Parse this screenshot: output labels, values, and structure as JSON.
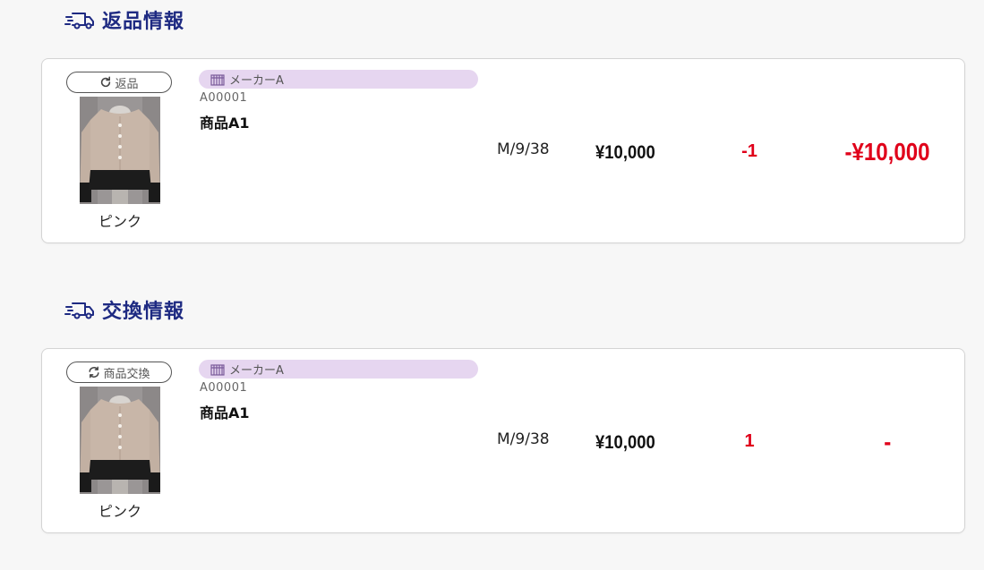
{
  "sections": [
    {
      "title": "返品情報",
      "item": {
        "status_label": "返品",
        "status_icon": "refresh-icon",
        "maker": "メーカーA",
        "sku": "A00001",
        "name": "商品A1",
        "color": "ピンク",
        "variant": "M/9/38",
        "price": "¥10,000",
        "quantity": "-1",
        "subtotal": "-¥10,000"
      }
    },
    {
      "title": "交換情報",
      "item": {
        "status_label": "商品交換",
        "status_icon": "sync-icon",
        "maker": "メーカーA",
        "sku": "A00001",
        "name": "商品A1",
        "color": "ピンク",
        "variant": "M/9/38",
        "price": "¥10,000",
        "quantity": "1",
        "subtotal": "-"
      }
    }
  ],
  "colors": {
    "heading": "#1e2a82",
    "accent_red": "#e0001a",
    "maker_tag_bg": "#e6d6f0"
  }
}
